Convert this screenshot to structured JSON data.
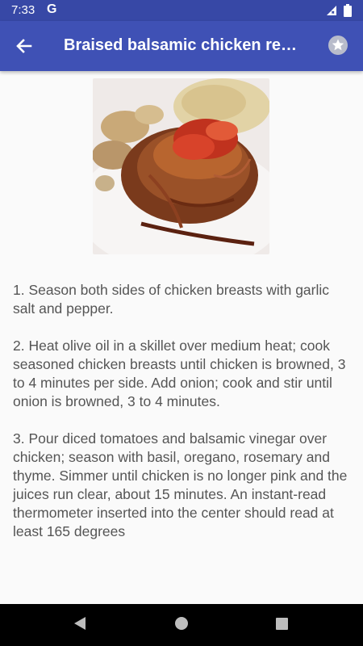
{
  "status_bar": {
    "time": "7:33",
    "g_logo": "G",
    "icons": [
      "signal-icon",
      "battery-icon"
    ]
  },
  "app_bar": {
    "title": "Braised balsamic chicken re…",
    "back_icon": "arrow-left-icon",
    "favorite_icon": "star-icon"
  },
  "recipe": {
    "steps": [
      "1. Season both sides of chicken breasts with garlic salt and pepper.",
      "2. Heat olive oil in a skillet over medium heat; cook seasoned chicken breasts until chicken is browned, 3 to 4 minutes per side. Add onion; cook and stir until onion is browned, 3 to 4 minutes.",
      "3. Pour diced tomatoes and balsamic vinegar over chicken; season with basil, oregano, rosemary and thyme. Simmer until chicken is no longer pink and the juices run clear, about 15 minutes. An instant-read thermometer inserted into the center should read at least 165 degrees"
    ]
  },
  "nav_bar": {
    "buttons": [
      "back-triangle-icon",
      "home-circle-icon",
      "recents-square-icon"
    ]
  },
  "colors": {
    "primary": "#3f51b5",
    "primary_dark": "#3748a6",
    "text": "#555555"
  }
}
